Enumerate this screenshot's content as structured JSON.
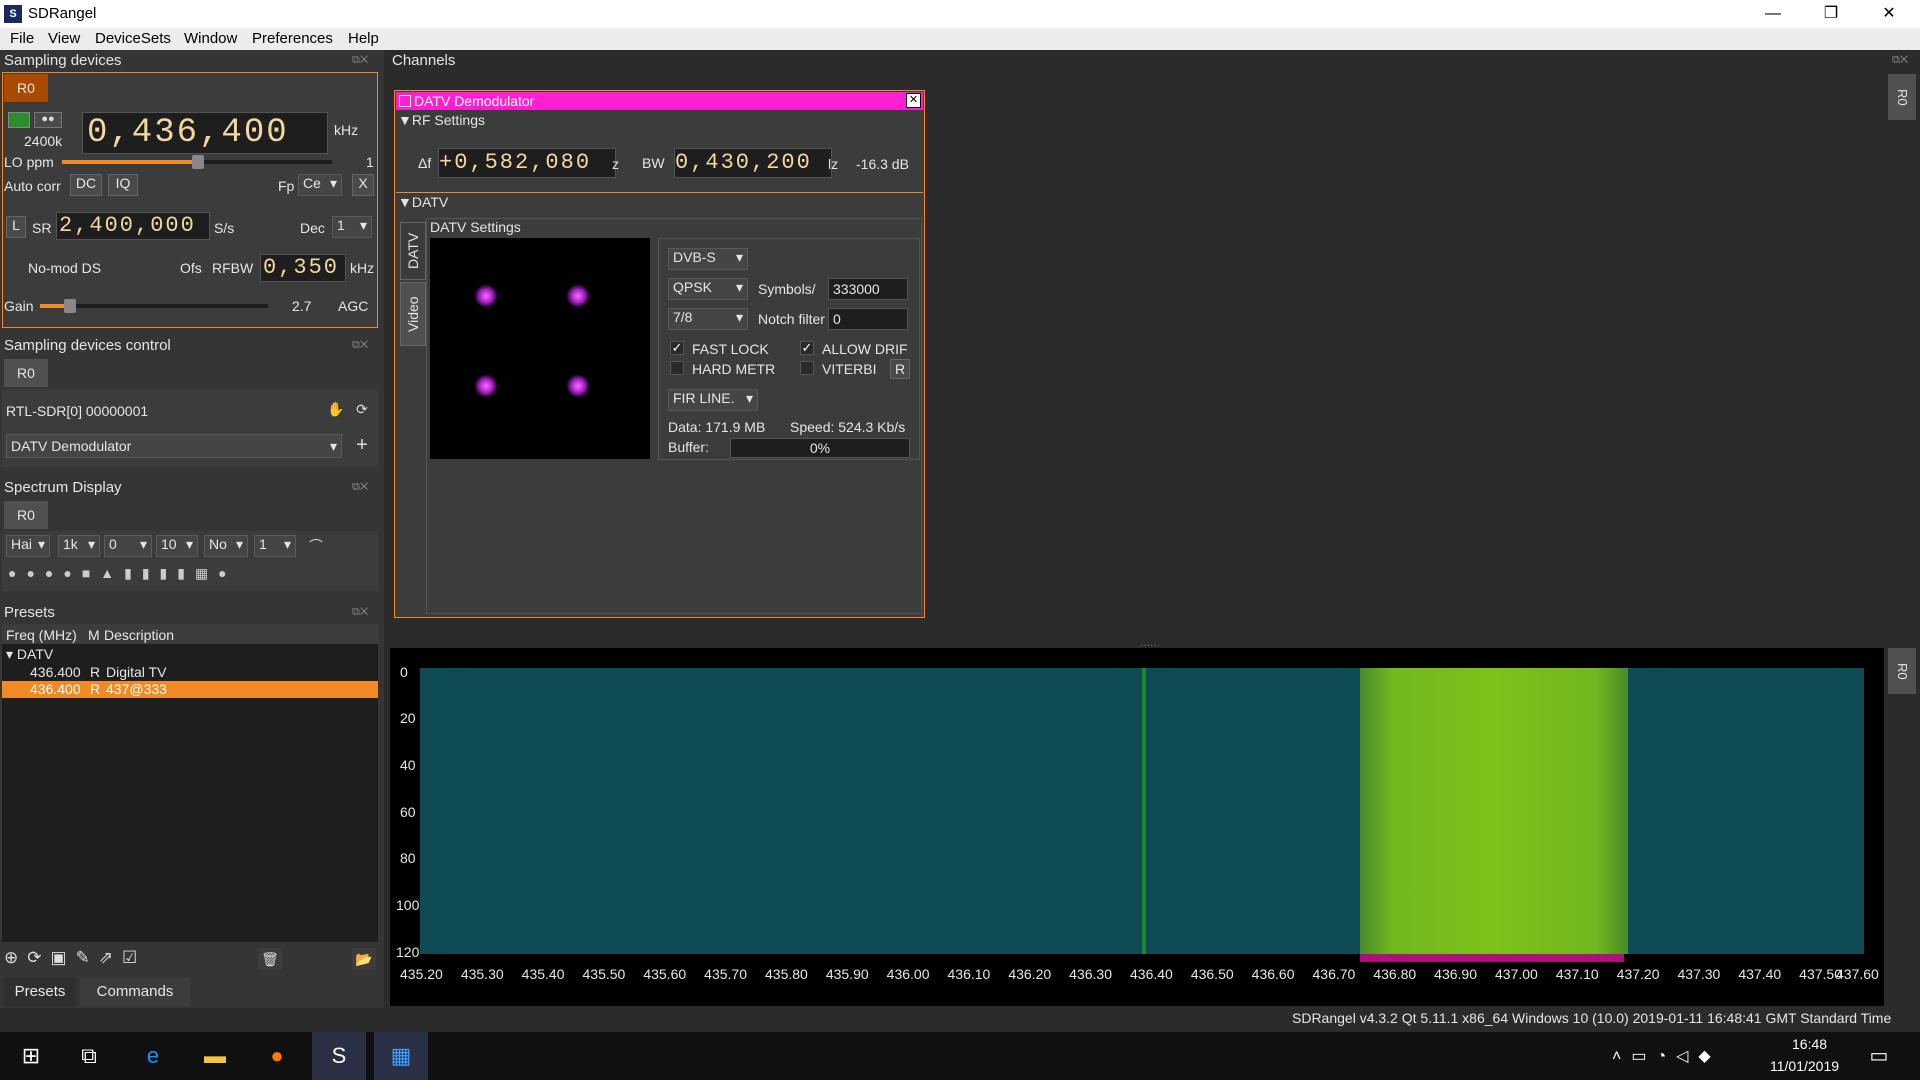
{
  "app": {
    "title": "SDRangel",
    "logo": "S"
  },
  "window_controls": {
    "minimize": "—",
    "maximize": "❐",
    "close": "✕"
  },
  "menu": [
    "File",
    "View",
    "DeviceSets",
    "Window",
    "Preferences",
    "Help"
  ],
  "sampling": {
    "title": "Sampling devices",
    "tab": "R0",
    "freq": "0,436,400",
    "freq_unit": "kHz",
    "rate": "2400k",
    "lo_label": "LO ppm",
    "lo_value": "1",
    "autocorr": "Auto corr",
    "dc": "DC",
    "iq": "IQ",
    "fp": "Fp",
    "fp_val": "Ce",
    "x": "X",
    "l": "L",
    "sr": "SR",
    "sr_val": "2,400,000",
    "sr_unit": "S/s",
    "dec": "Dec",
    "dec_val": "1",
    "nomod": "No-mod DS",
    "ofs": "Ofs",
    "rfbw": "RFBW",
    "rfbw_val": "0,350",
    "rfbw_unit": "kHz",
    "gain": "Gain",
    "gain_val": "2.7",
    "agc": "AGC"
  },
  "control": {
    "title": "Sampling devices control",
    "tab": "R0",
    "device": "RTL-SDR[0] 00000001",
    "channel": "DATV Demodulator",
    "add": "+"
  },
  "spectrum": {
    "title": "Spectrum Display",
    "tab": "R0",
    "c1": "Hai",
    "c2": "1k",
    "c3": "0",
    "c4": "10",
    "c5": "No",
    "c6": "1"
  },
  "presets": {
    "title": "Presets",
    "col1": "Freq (MHz)",
    "col2": "M",
    "col3": "Description",
    "group": "DATV",
    "items": [
      {
        "freq": "436.400",
        "m": "R",
        "desc": "Digital TV"
      },
      {
        "freq": "436.400",
        "m": "R",
        "desc": "437@333"
      }
    ],
    "tab1": "Presets",
    "tab2": "Commands"
  },
  "channels": {
    "title": "Channels",
    "side_tab": "R0"
  },
  "datv": {
    "title": "DATV Demodulator",
    "close": "✕",
    "rf": "RF Settings",
    "df": "Δf",
    "df_val": "+0,582,080",
    "df_unit": "z",
    "bw": "BW",
    "bw_val": "0,430,200",
    "bw_unit": "lz",
    "db": "-16.3 dB",
    "section": "DATV",
    "vtab1": "DATV",
    "vtab2": "Video",
    "settings": "DATV Settings",
    "standard": "DVB-S",
    "mod": "QPSK",
    "symbols_label": "Symbols/",
    "symbols": "333000",
    "fec": "7/8",
    "notch_label": "Notch filter",
    "notch": "0",
    "fastlock": "FAST LOCK",
    "allowdrift": "ALLOW DRIF",
    "hardmetr": "HARD METR",
    "viterbi": "VITERBI",
    "r": "R",
    "fir": "FIR LINE.",
    "data": "Data: 171.9 MB",
    "speed": "Speed: 524.3 Kb/s",
    "buffer_label": "Buffer:",
    "buffer": "0%",
    "buffer_level": 0
  },
  "waterfall": {
    "side_tab": "R0",
    "y_ticks": [
      "0",
      "20",
      "40",
      "60",
      "80",
      "100",
      "120"
    ],
    "x_ticks": [
      "435.20",
      "435.30",
      "435.40",
      "435.50",
      "435.60",
      "435.70",
      "435.80",
      "435.90",
      "436.00",
      "436.10",
      "436.20",
      "436.30",
      "436.40",
      "436.50",
      "436.60",
      "436.70",
      "436.80",
      "436.90",
      "437.00",
      "437.10",
      "437.20",
      "437.30",
      "437.40",
      "437.50",
      "437.60"
    ]
  },
  "status": "SDRangel v4.3.2 Qt 5.11.1 x86_64 Windows 10 (10.0) 2019-01-11 16:48:41 GMT Standard Time",
  "taskbar": {
    "time": "16:48",
    "date": "11/01/2019"
  },
  "colors": {
    "accent": "#f08a24",
    "magenta": "#ff1fd2"
  }
}
